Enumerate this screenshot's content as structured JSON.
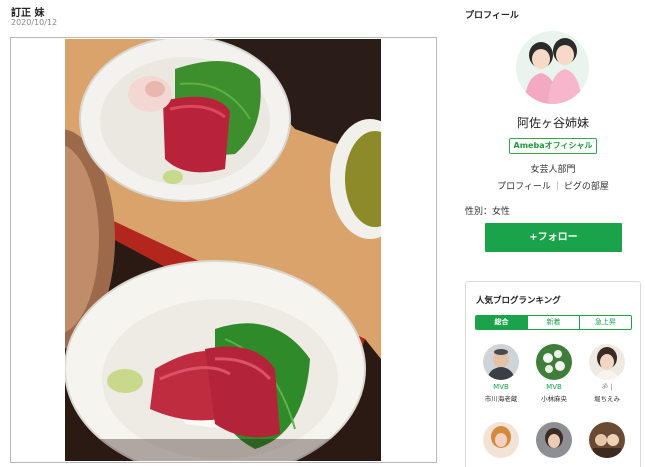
{
  "post": {
    "title": "訂正 妹",
    "date": "2020/10/12"
  },
  "sidebar": {
    "heading": "プロフィール",
    "blog_name": "阿佐ヶ谷姉妹",
    "official_badge": "Amebaオフィシャル",
    "category": "女芸人部門",
    "links": [
      "プロフィール",
      "ピグの部屋"
    ],
    "gender": "性別：女性",
    "follow_label": "+フォロー"
  },
  "ranking": {
    "title": "人気ブログランキング",
    "tabs": [
      {
        "label": "総合",
        "active": true
      },
      {
        "label": "新着",
        "active": false
      },
      {
        "label": "急上昇",
        "active": false
      }
    ],
    "items": [
      {
        "badge": "MVB",
        "name": "市川海老蔵"
      },
      {
        "badge": "MVB",
        "name": "小林麻央"
      },
      {
        "badge": "ॐ |",
        "name": "堀ちえみ"
      },
      {
        "badge": "",
        "name": ""
      },
      {
        "badge": "",
        "name": ""
      },
      {
        "badge": "",
        "name": ""
      }
    ]
  },
  "colors": {
    "accent_green": "#1aa34a",
    "text": "#333333"
  }
}
